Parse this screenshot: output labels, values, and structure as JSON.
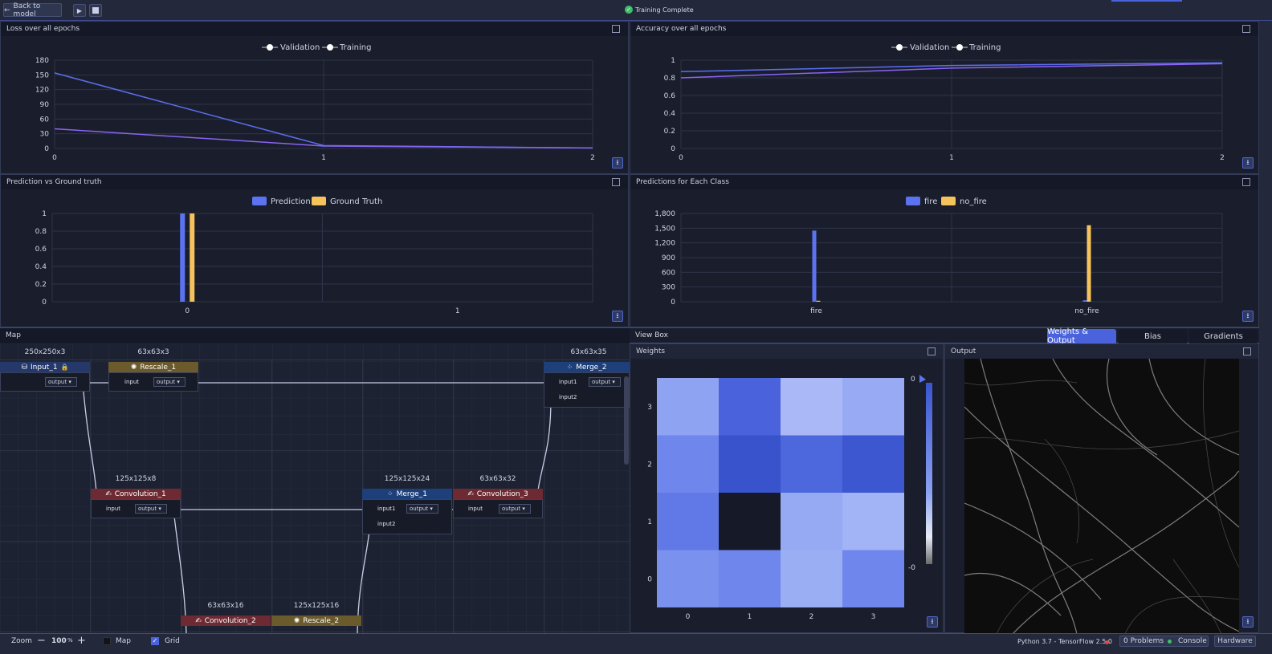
{
  "topbar": {
    "back_label": "Back to model",
    "status": "Training Complete"
  },
  "loss_panel": {
    "title": "Loss over all epochs",
    "chart_data": {
      "type": "line",
      "x": [
        0,
        1,
        2
      ],
      "ylim": [
        0,
        180
      ],
      "yticks": [
        "180",
        "150",
        "120",
        "90",
        "60",
        "30",
        "0"
      ],
      "xticks": [
        "0",
        "1",
        "2"
      ],
      "series": [
        {
          "name": "Validation",
          "values": [
            154,
            6,
            1
          ],
          "color": "#5b6ef0"
        },
        {
          "name": "Training",
          "values": [
            40,
            5,
            1
          ],
          "color": "#8a63f3"
        }
      ]
    }
  },
  "acc_panel": {
    "title": "Accuracy over all epochs",
    "chart_data": {
      "type": "line",
      "x": [
        0,
        1,
        2
      ],
      "ylim": [
        0,
        1
      ],
      "yticks": [
        "1",
        "0.8",
        "0.6",
        "0.4",
        "0.2",
        "0"
      ],
      "xticks": [
        "0",
        "1",
        "2"
      ],
      "series": [
        {
          "name": "Validation",
          "values": [
            0.87,
            0.94,
            0.97
          ],
          "color": "#5b6ef0"
        },
        {
          "name": "Training",
          "values": [
            0.8,
            0.91,
            0.96
          ],
          "color": "#8a63f3"
        }
      ]
    }
  },
  "pred_panel": {
    "title": "Prediction vs Ground truth",
    "chart_data": {
      "type": "bar",
      "categories": [
        "0",
        "1"
      ],
      "ylim": [
        0,
        1
      ],
      "yticks": [
        "1",
        "0.8",
        "0.6",
        "0.4",
        "0.2",
        "0"
      ],
      "series": [
        {
          "name": "Prediction",
          "values": [
            1,
            0
          ],
          "color": "#5b73f0"
        },
        {
          "name": "Ground Truth",
          "values": [
            1,
            0
          ],
          "color": "#f5c25c"
        }
      ]
    }
  },
  "class_panel": {
    "title": "Predictions for Each Class",
    "chart_data": {
      "type": "bar",
      "categories": [
        "fire",
        "no_fire"
      ],
      "ylim": [
        0,
        1800
      ],
      "yticks": [
        "1,800",
        "1,500",
        "1,200",
        "900",
        "600",
        "300",
        "0"
      ],
      "series": [
        {
          "name": "fire",
          "values": [
            1450,
            30
          ],
          "color": "#5b73f0"
        },
        {
          "name": "no_fire",
          "values": [
            20,
            1560
          ],
          "color": "#f5c25c"
        }
      ]
    }
  },
  "map": {
    "title": "Map",
    "nodes": [
      {
        "name": "Input_1",
        "dim": "250x250x3",
        "out": "output"
      },
      {
        "name": "Rescale_1",
        "dim": "63x63x3",
        "in": "input",
        "out": "output"
      },
      {
        "name": "Merge_2",
        "dim": "63x63x35",
        "in1": "input1",
        "in2": "input2",
        "out": "output"
      },
      {
        "name": "Convolution_1",
        "dim": "125x125x8",
        "in": "input",
        "out": "output"
      },
      {
        "name": "Merge_1",
        "dim": "125x125x24",
        "in1": "input1",
        "in2": "input2",
        "out": "output"
      },
      {
        "name": "Convolution_3",
        "dim": "63x63x32",
        "in": "input",
        "out": "output"
      },
      {
        "name": "Convolution_2",
        "dim": "63x63x16"
      },
      {
        "name": "Rescale_2",
        "dim": "125x125x16"
      }
    ]
  },
  "viewbox": {
    "title": "View Box",
    "tabs": [
      "Weights & Output",
      "Bias",
      "Gradients"
    ],
    "weights_title": "Weights",
    "output_title": "Output",
    "heatmap": {
      "type": "heatmap",
      "xticks": [
        "0",
        "1",
        "2",
        "3"
      ],
      "yticks": [
        "3",
        "2",
        "1",
        "0"
      ],
      "scale_top": "0",
      "scale_bottom": "-0",
      "cells": [
        [
          "#8ea3f2",
          "#4a63dc",
          "#aab8f7",
          "#98aaf3"
        ],
        [
          "#6f86ec",
          "#3953cc",
          "#4d67dc",
          "#3c57cf"
        ],
        [
          "#6079e6",
          "#161a28",
          "#96a9f3",
          "#a2b3f6"
        ],
        [
          "#7b91ee",
          "#6f86ec",
          "#9aaef4",
          "#6f86ec"
        ]
      ]
    }
  },
  "statusbar": {
    "zoom_label": "Zoom",
    "zoom_value": "100",
    "zoom_unit": "%",
    "map_label": "Map",
    "grid_label": "Grid",
    "runtime": "Python 3.7 - TensorFlow 2.5.0",
    "problems": "0 Problems",
    "console": "Console",
    "hardware": "Hardware"
  }
}
